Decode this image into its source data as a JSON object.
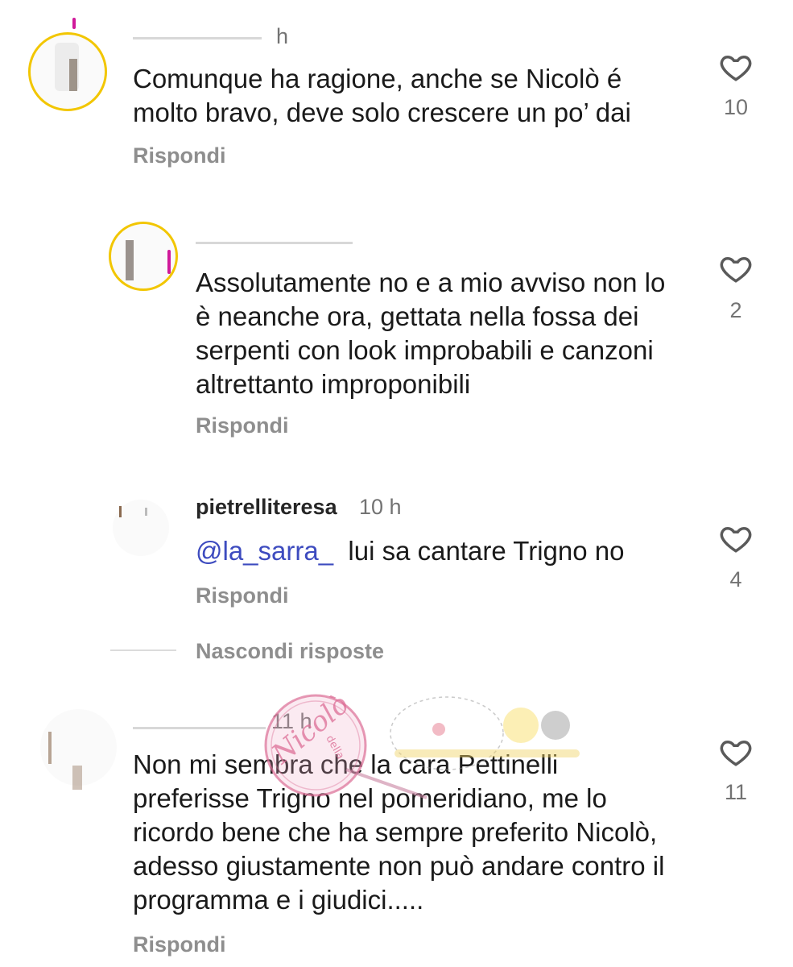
{
  "comments": [
    {
      "username": "",
      "time": "h",
      "text": "Comunque ha ragione, anche se Nicolò é molto bravo, deve solo crescere un po’ dai",
      "reply_label": "Rispondi",
      "likes": "10"
    },
    {
      "username": "",
      "time": "",
      "text": "Assolutamente no e a mio avviso non lo è neanche ora, gettata nella fossa dei serpenti con look improbabili e canzoni altrettanto improponibili",
      "reply_label": "Rispondi",
      "likes": "2"
    },
    {
      "username": "pietrelliteresa",
      "time": "10 h",
      "mention": "@la_sarra_",
      "text": "lui sa cantare Trigno no",
      "reply_label": "Rispondi",
      "likes": "4"
    },
    {
      "username": "",
      "time": "11 h",
      "text": "Non mi sembra che la cara Pettinelli preferisse Trigno nel pomeridiano, me lo ricordo bene che ha sempre preferito Nicolò,  adesso giustamente non può andare contro il programma e i giudici.....",
      "reply_label": "Rispondi",
      "likes": "11"
    }
  ],
  "hide_replies_label": "Nascondi risposte",
  "watermark": {
    "name": "Nicolò",
    "sub": "della"
  },
  "colors": {
    "mention": "#3d4bbf",
    "muted": "#8e8e8e",
    "story_ring": "#d0199a"
  },
  "icons": {
    "like": "heart-outline-icon"
  }
}
